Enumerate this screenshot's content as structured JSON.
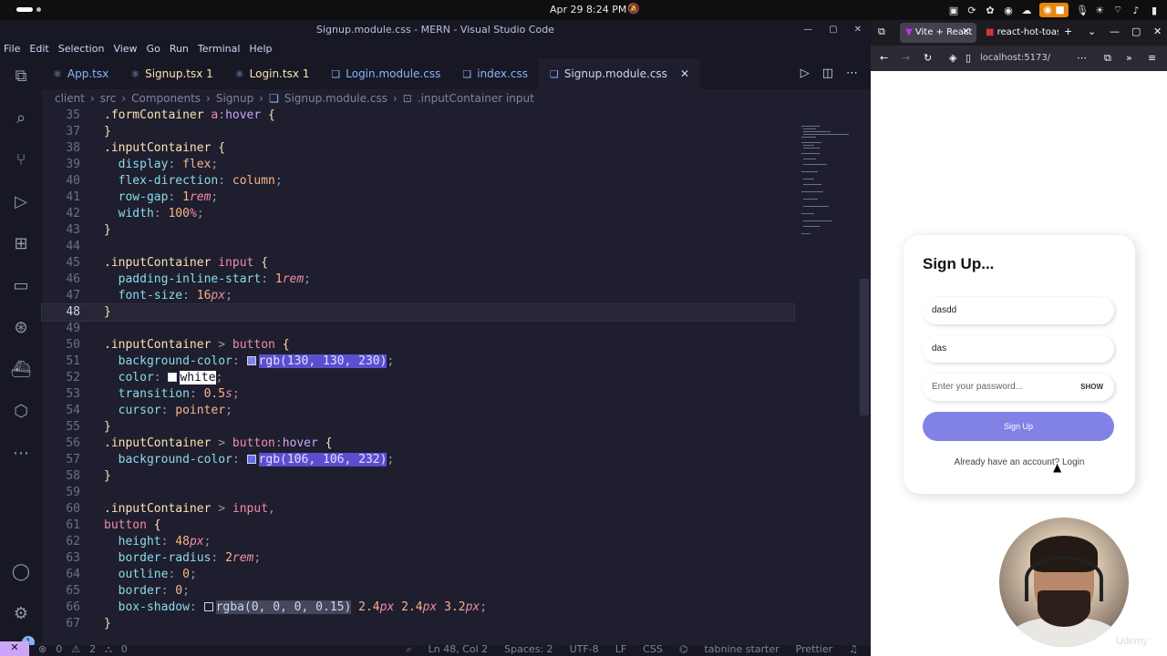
{
  "system": {
    "date": "Apr 29",
    "time": "8:24 PM"
  },
  "vscode": {
    "window_title": "Signup.module.css - MERN - Visual Studio Code",
    "menu": [
      "File",
      "Edit",
      "Selection",
      "View",
      "Go",
      "Run",
      "Terminal",
      "Help"
    ],
    "tabs": [
      {
        "label": "App.tsx",
        "icon": "react-icon",
        "modified": ""
      },
      {
        "label": "Signup.tsx 1",
        "icon": "react-icon",
        "modified": ""
      },
      {
        "label": "Login.tsx 1",
        "icon": "react-icon",
        "modified": ""
      },
      {
        "label": "Login.module.css",
        "icon": "css-icon",
        "modified": ""
      },
      {
        "label": "index.css",
        "icon": "css-icon",
        "modified": ""
      },
      {
        "label": "Signup.module.css",
        "icon": "css-icon",
        "modified": "",
        "active": true
      }
    ],
    "breadcrumb": [
      "client",
      "src",
      "Components",
      "Signup",
      "Signup.module.css",
      ".inputContainer input"
    ],
    "cursor_line": 48,
    "status": {
      "errors": "0",
      "warnings": "2",
      "ports": "0",
      "position": "Ln 48, Col 2",
      "spaces": "Spaces: 2",
      "encoding": "UTF-8",
      "eol": "LF",
      "language": "CSS",
      "tabnine": "tabnine starter",
      "prettier": "Prettier"
    },
    "activity_badge": "1"
  },
  "browser": {
    "tabs": [
      "Vite + React",
      "react-hot-toast"
    ],
    "url": "localhost:5173/",
    "signup": {
      "title": "Sign Up...",
      "name_value": "dasdd",
      "email_value": "das",
      "password_placeholder": "Enter your password...",
      "show_label": "SHOW",
      "button_label": "Sign Up",
      "already_text": "Already have an account? Login"
    }
  },
  "watermark": "Udemy"
}
